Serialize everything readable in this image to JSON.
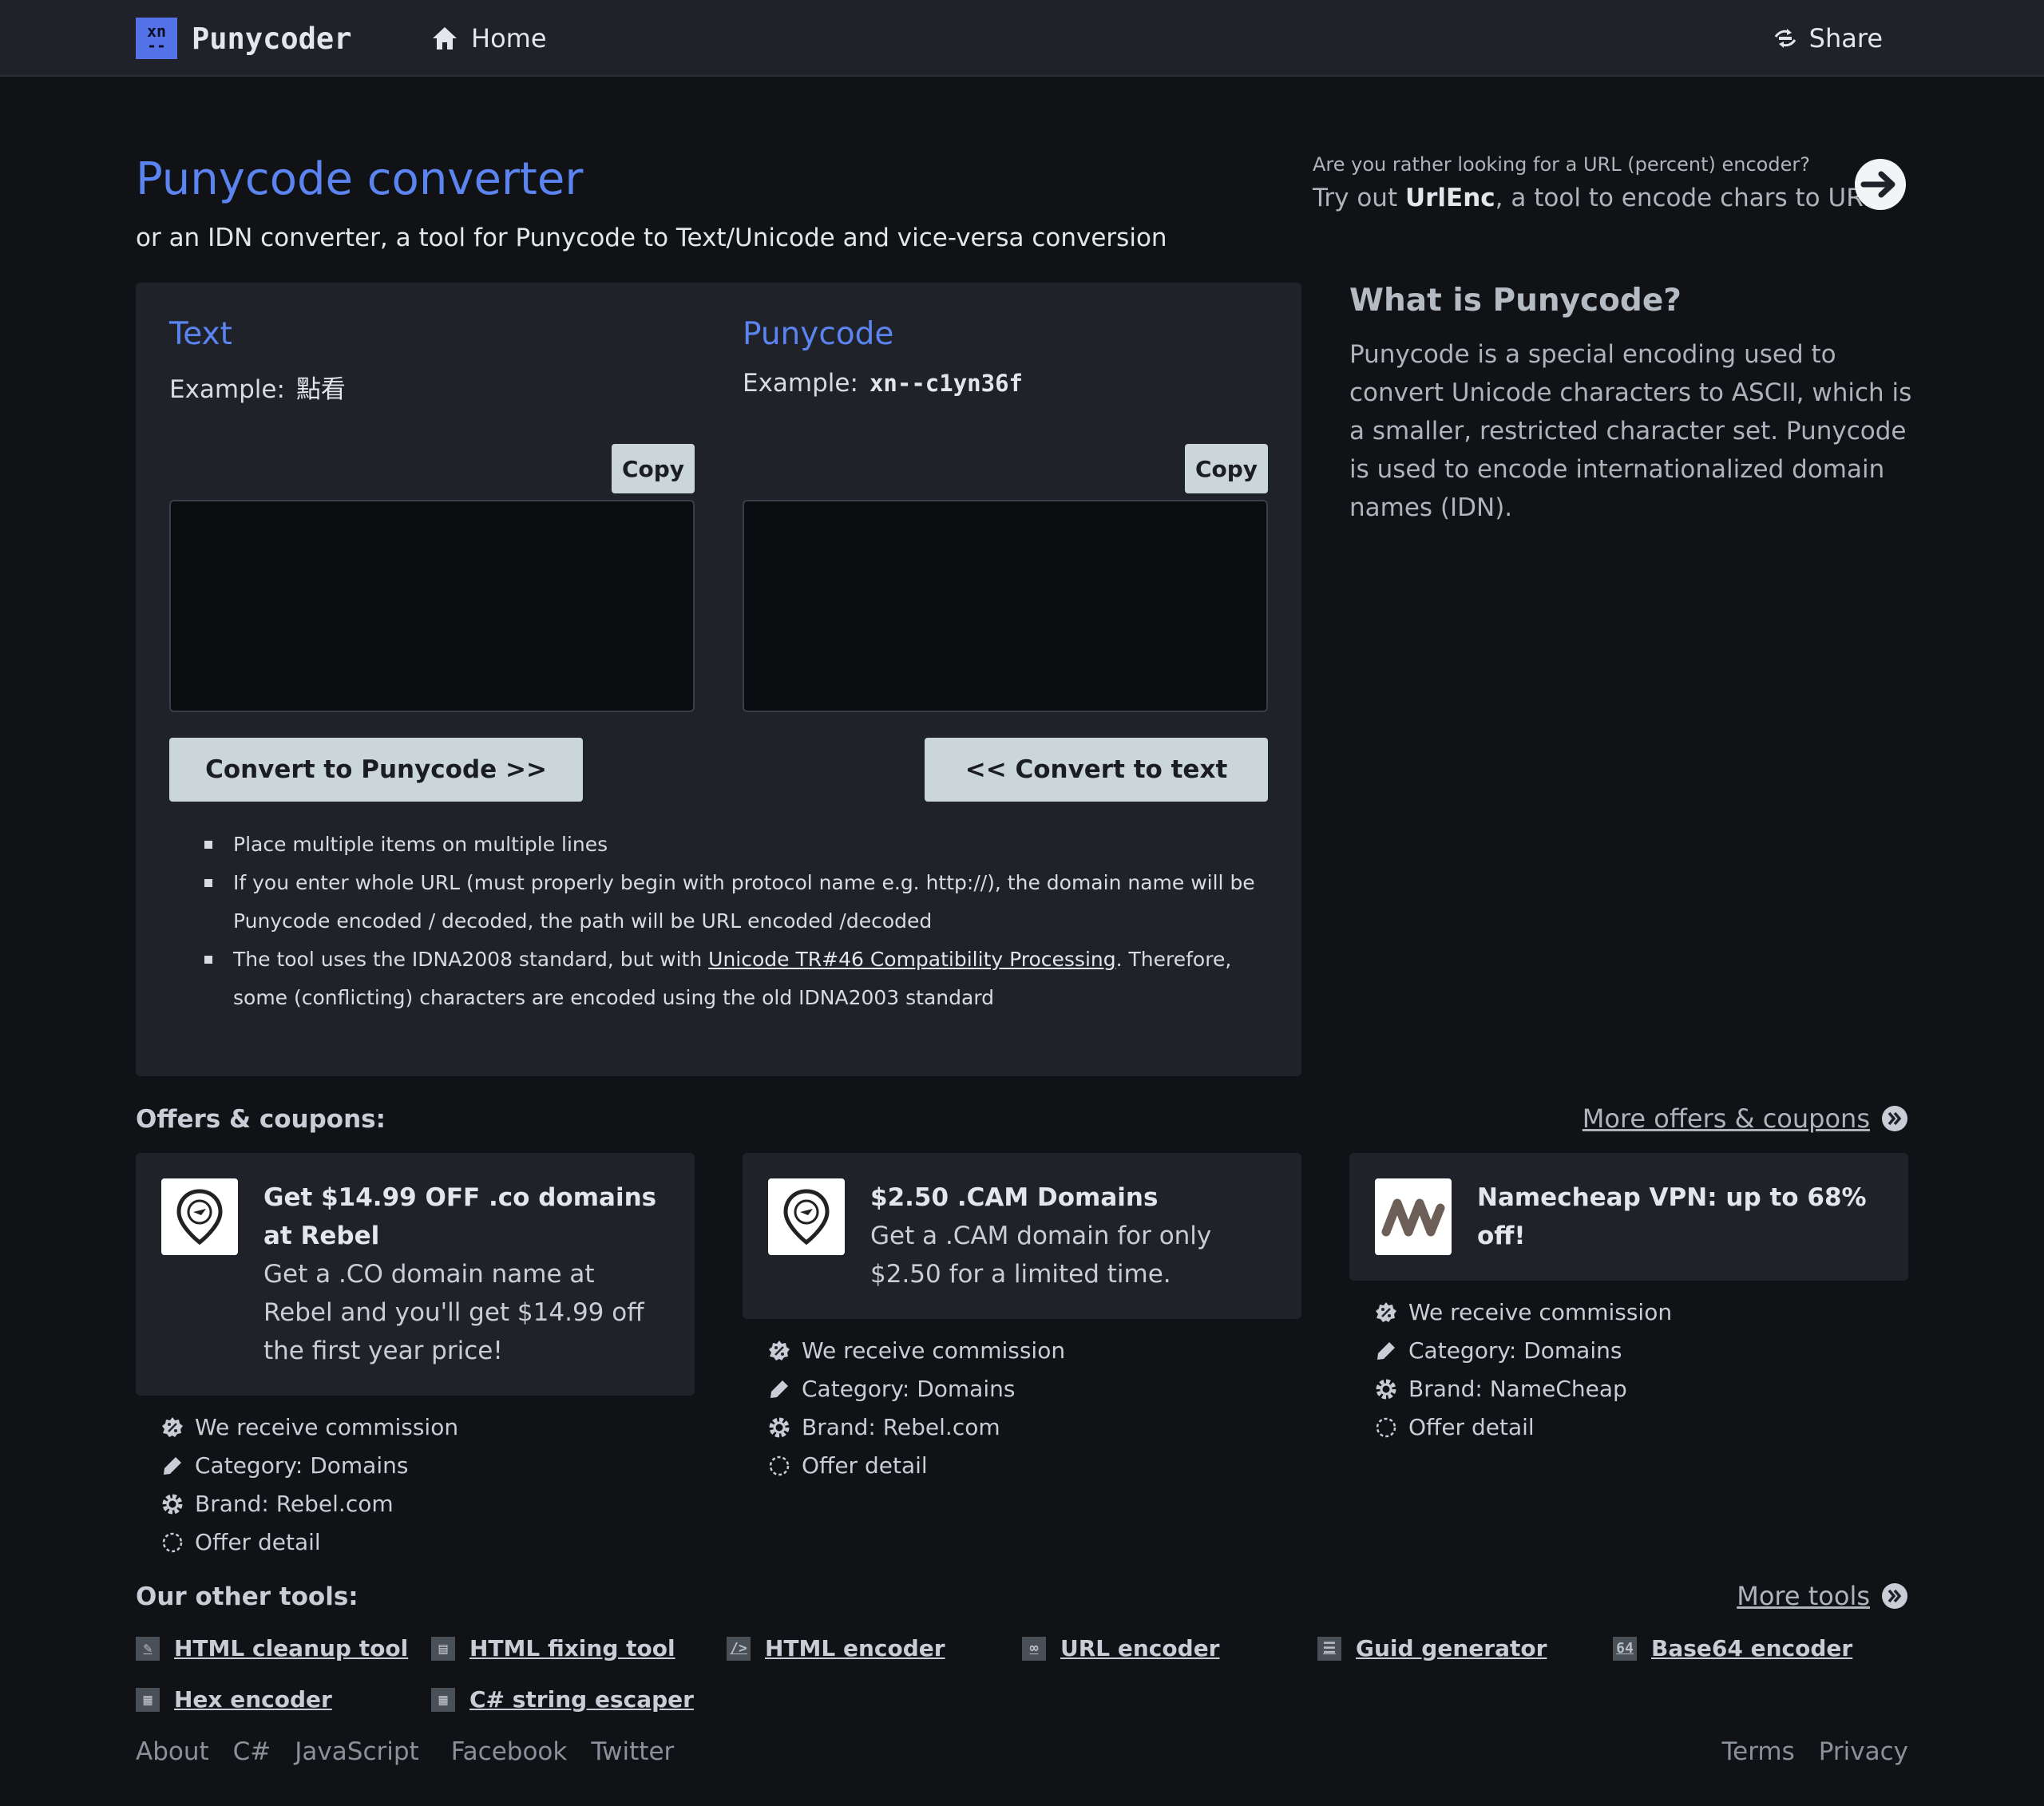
{
  "nav": {
    "logo_top": "xn",
    "logo_bottom": "--",
    "brand": "Punycoder",
    "home": "Home",
    "share": "Share"
  },
  "header": {
    "title": "Punycode converter",
    "subtitle": "or an IDN converter, a tool for Punycode to Text/Unicode and vice-versa conversion",
    "alt_question": "Are you rather looking for a URL (percent) encoder?",
    "alt_pre": "Try out ",
    "alt_name": "UrlEnc",
    "alt_post": ", a tool to encode chars to URLs"
  },
  "converter": {
    "text_title": "Text",
    "text_example_label": "Example:",
    "text_example": "點看",
    "puny_title": "Punycode",
    "puny_example_label": "Example:",
    "puny_example": "xn--c1yn36f",
    "copy_label": "Copy",
    "text_value": "",
    "puny_value": "",
    "btn_to_puny": "Convert to Punycode >>",
    "btn_to_text": "<< Convert to text",
    "notes": {
      "n1": "Place multiple items on multiple lines",
      "n2": "If you enter whole URL (must properly begin with protocol name e.g. http://), the domain name will be Punycode encoded / decoded, the path will be URL encoded /decoded",
      "n3_pre": "The tool uses the IDNA2008 standard, but with ",
      "n3_link": "Unicode TR#46 Compatibility Processing",
      "n3_post": ". Therefore, some (conflicting) characters are encoded using the old IDNA2003 standard"
    }
  },
  "what_is": {
    "title": "What is Punycode?",
    "text": "Punycode is a special encoding used to convert Unicode characters to ASCII, which is a smaller, restricted character set. Punycode is used to encode internationalized domain names (IDN)."
  },
  "offers": {
    "title": "Offers & coupons:",
    "more": "More offers & coupons",
    "items": [
      {
        "title": "Get $14.99 OFF .co domains at Rebel",
        "desc": "Get a .CO domain name at Rebel and you'll get $14.99 off the first year price!",
        "commission": "We receive commission",
        "category": "Category: Domains",
        "brand": "Brand: Rebel.com",
        "detail": "Offer detail"
      },
      {
        "title": "$2.50 .CAM Domains",
        "desc": "Get a .CAM domain for only $2.50 for a limited time.",
        "commission": "We receive commission",
        "category": "Category: Domains",
        "brand": "Brand: Rebel.com",
        "detail": "Offer detail"
      },
      {
        "title": "Namecheap VPN: up to 68% off!",
        "desc": "",
        "commission": "We receive commission",
        "category": "Category: Domains",
        "brand": "Brand: NameCheap",
        "detail": "Offer detail"
      }
    ]
  },
  "tools": {
    "title": "Our other tools:",
    "more": "More tools",
    "items": [
      {
        "label": "HTML cleanup tool",
        "icon": "broom-icon"
      },
      {
        "label": "HTML fixing tool",
        "icon": "fix-icon"
      },
      {
        "label": "HTML encoder",
        "icon": "code-icon",
        "glyph": "/>"
      },
      {
        "label": "URL encoder",
        "icon": "link-icon"
      },
      {
        "label": "Guid generator",
        "icon": "barcode-icon"
      },
      {
        "label": "Base64 encoder",
        "icon": "base64-icon",
        "glyph": "64"
      },
      {
        "label": "Hex encoder",
        "icon": "hex-icon"
      },
      {
        "label": "C# string escaper",
        "icon": "csharp-icon"
      }
    ]
  },
  "footer": {
    "about": "About",
    "csharp": "C#",
    "javascript": "JavaScript",
    "facebook": "Facebook",
    "twitter": "Twitter",
    "terms": "Terms",
    "privacy": "Privacy"
  },
  "colors": {
    "accent": "#5b84f0",
    "background": "#101216",
    "panel": "#1f2329",
    "button": "#cbd6da"
  }
}
